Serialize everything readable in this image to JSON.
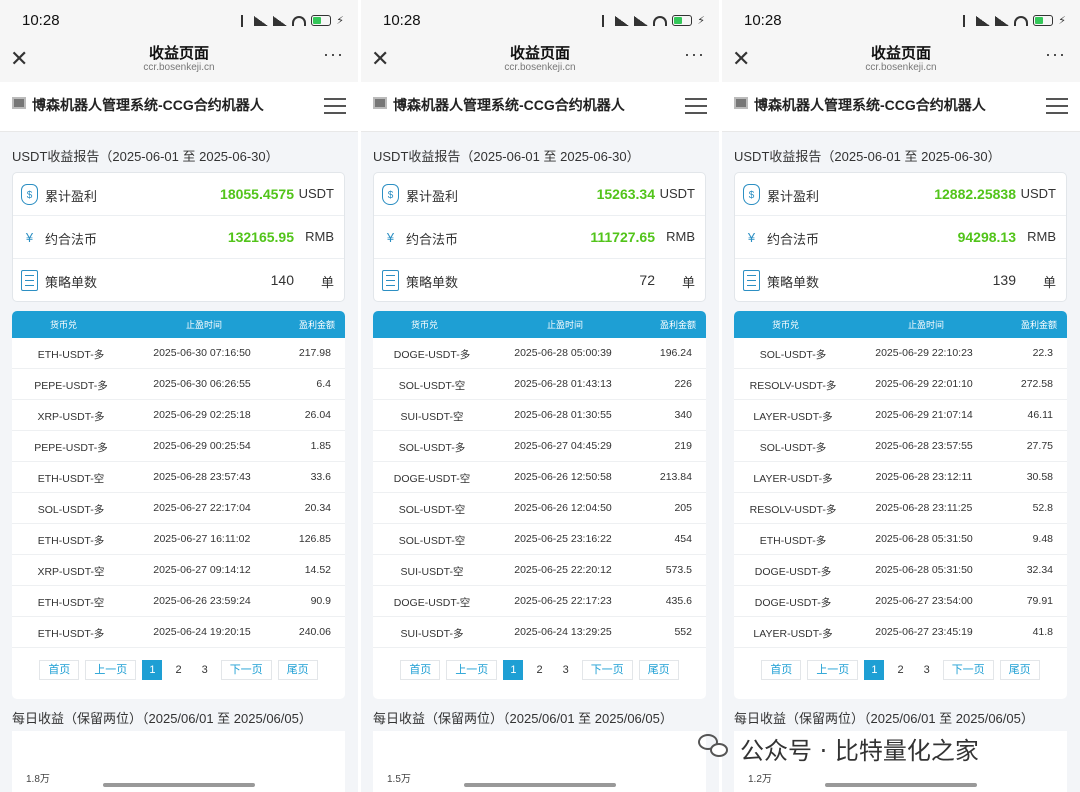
{
  "colors": {
    "accent": "#1e9fd4",
    "profit_green": "#52c41a"
  },
  "phones": [
    {
      "status": {
        "time": "10:28",
        "battery_level": 0.5
      },
      "nav": {
        "close": "✕",
        "title": "收益页面",
        "url": "ccr.bosenkeji.cn",
        "more": "···"
      },
      "app_title": "博森机器人管理系统-CCG合约机器人",
      "report_title": "USDT收益报告（2025-06-01 至 2025-06-30）",
      "summary": [
        {
          "icon": "money-bag-icon",
          "label": "累计盈利",
          "value": "18055.4575",
          "unit": "USDT"
        },
        {
          "icon": "yen-icon",
          "label": "约合法币",
          "value": "132165.95",
          "unit": "RMB"
        },
        {
          "icon": "document-icon",
          "label": "策略单数",
          "value": "140",
          "unit": "单"
        }
      ],
      "table": {
        "headers": [
          "货币兑",
          "止盈时间",
          "盈利金额"
        ],
        "rows": [
          [
            "ETH-USDT-多",
            "2025-06-30 07:16:50",
            "217.98"
          ],
          [
            "PEPE-USDT-多",
            "2025-06-30 06:26:55",
            "6.4"
          ],
          [
            "XRP-USDT-多",
            "2025-06-29 02:25:18",
            "26.04"
          ],
          [
            "PEPE-USDT-多",
            "2025-06-29 00:25:54",
            "1.85"
          ],
          [
            "ETH-USDT-空",
            "2025-06-28 23:57:43",
            "33.6"
          ],
          [
            "SOL-USDT-多",
            "2025-06-27 22:17:04",
            "20.34"
          ],
          [
            "ETH-USDT-多",
            "2025-06-27 16:11:02",
            "126.85"
          ],
          [
            "XRP-USDT-空",
            "2025-06-27 09:14:12",
            "14.52"
          ],
          [
            "ETH-USDT-空",
            "2025-06-26 23:59:24",
            "90.9"
          ],
          [
            "ETH-USDT-多",
            "2025-06-24 19:20:15",
            "240.06"
          ]
        ]
      },
      "pager": {
        "first": "首页",
        "prev": "上一页",
        "pages": [
          "1",
          "2",
          "3"
        ],
        "next": "下一页",
        "last": "尾页",
        "current": "1"
      },
      "daily_title": "每日收益（保留两位）（2025/06/01 至 2025/06/05）",
      "daily_ytick": "1.8万"
    },
    {
      "status": {
        "time": "10:28",
        "battery_level": 0.5
      },
      "nav": {
        "close": "✕",
        "title": "收益页面",
        "url": "ccr.bosenkeji.cn",
        "more": "···"
      },
      "app_title": "博森机器人管理系统-CCG合约机器人",
      "report_title": "USDT收益报告（2025-06-01 至 2025-06-30）",
      "summary": [
        {
          "icon": "money-bag-icon",
          "label": "累计盈利",
          "value": "15263.34",
          "unit": "USDT"
        },
        {
          "icon": "yen-icon",
          "label": "约合法币",
          "value": "111727.65",
          "unit": "RMB"
        },
        {
          "icon": "document-icon",
          "label": "策略单数",
          "value": "72",
          "unit": "单"
        }
      ],
      "table": {
        "headers": [
          "货币兑",
          "止盈时间",
          "盈利金额"
        ],
        "rows": [
          [
            "DOGE-USDT-多",
            "2025-06-28 05:00:39",
            "196.24"
          ],
          [
            "SOL-USDT-空",
            "2025-06-28 01:43:13",
            "226"
          ],
          [
            "SUI-USDT-空",
            "2025-06-28 01:30:55",
            "340"
          ],
          [
            "SOL-USDT-多",
            "2025-06-27 04:45:29",
            "219"
          ],
          [
            "DOGE-USDT-空",
            "2025-06-26 12:50:58",
            "213.84"
          ],
          [
            "SOL-USDT-空",
            "2025-06-26 12:04:50",
            "205"
          ],
          [
            "SOL-USDT-空",
            "2025-06-25 23:16:22",
            "454"
          ],
          [
            "SUI-USDT-空",
            "2025-06-25 22:20:12",
            "573.5"
          ],
          [
            "DOGE-USDT-空",
            "2025-06-25 22:17:23",
            "435.6"
          ],
          [
            "SUI-USDT-多",
            "2025-06-24 13:29:25",
            "552"
          ]
        ]
      },
      "pager": {
        "first": "首页",
        "prev": "上一页",
        "pages": [
          "1",
          "2",
          "3"
        ],
        "next": "下一页",
        "last": "尾页",
        "current": "1"
      },
      "daily_title": "每日收益（保留两位）（2025/06/01 至 2025/06/05）",
      "daily_ytick": "1.5万"
    },
    {
      "status": {
        "time": "10:28",
        "battery_level": 0.5
      },
      "nav": {
        "close": "✕",
        "title": "收益页面",
        "url": "ccr.bosenkeji.cn",
        "more": "···"
      },
      "app_title": "博森机器人管理系统-CCG合约机器人",
      "report_title": "USDT收益报告（2025-06-01 至 2025-06-30）",
      "summary": [
        {
          "icon": "money-bag-icon",
          "label": "累计盈利",
          "value": "12882.25838",
          "unit": "USDT"
        },
        {
          "icon": "yen-icon",
          "label": "约合法币",
          "value": "94298.13",
          "unit": "RMB"
        },
        {
          "icon": "document-icon",
          "label": "策略单数",
          "value": "139",
          "unit": "单"
        }
      ],
      "table": {
        "headers": [
          "货币兑",
          "止盈时间",
          "盈利金额"
        ],
        "rows": [
          [
            "SOL-USDT-多",
            "2025-06-29 22:10:23",
            "22.3"
          ],
          [
            "RESOLV-USDT-多",
            "2025-06-29 22:01:10",
            "272.58"
          ],
          [
            "LAYER-USDT-多",
            "2025-06-29 21:07:14",
            "46.11"
          ],
          [
            "SOL-USDT-多",
            "2025-06-28 23:57:55",
            "27.75"
          ],
          [
            "LAYER-USDT-多",
            "2025-06-28 23:12:11",
            "30.58"
          ],
          [
            "RESOLV-USDT-多",
            "2025-06-28 23:11:25",
            "52.8"
          ],
          [
            "ETH-USDT-多",
            "2025-06-28 05:31:50",
            "9.48"
          ],
          [
            "DOGE-USDT-多",
            "2025-06-28 05:31:50",
            "32.34"
          ],
          [
            "DOGE-USDT-多",
            "2025-06-27 23:54:00",
            "79.91"
          ],
          [
            "LAYER-USDT-多",
            "2025-06-27 23:45:19",
            "41.8"
          ]
        ]
      },
      "pager": {
        "first": "首页",
        "prev": "上一页",
        "pages": [
          "1",
          "2",
          "3"
        ],
        "next": "下一页",
        "last": "尾页",
        "current": "1"
      },
      "daily_title": "每日收益（保留两位）（2025/06/01 至 2025/06/05）",
      "daily_ytick": "1.2万"
    }
  ],
  "watermark": {
    "icon": "wechat-icon",
    "text": "公众号 · 比特量化之家"
  }
}
